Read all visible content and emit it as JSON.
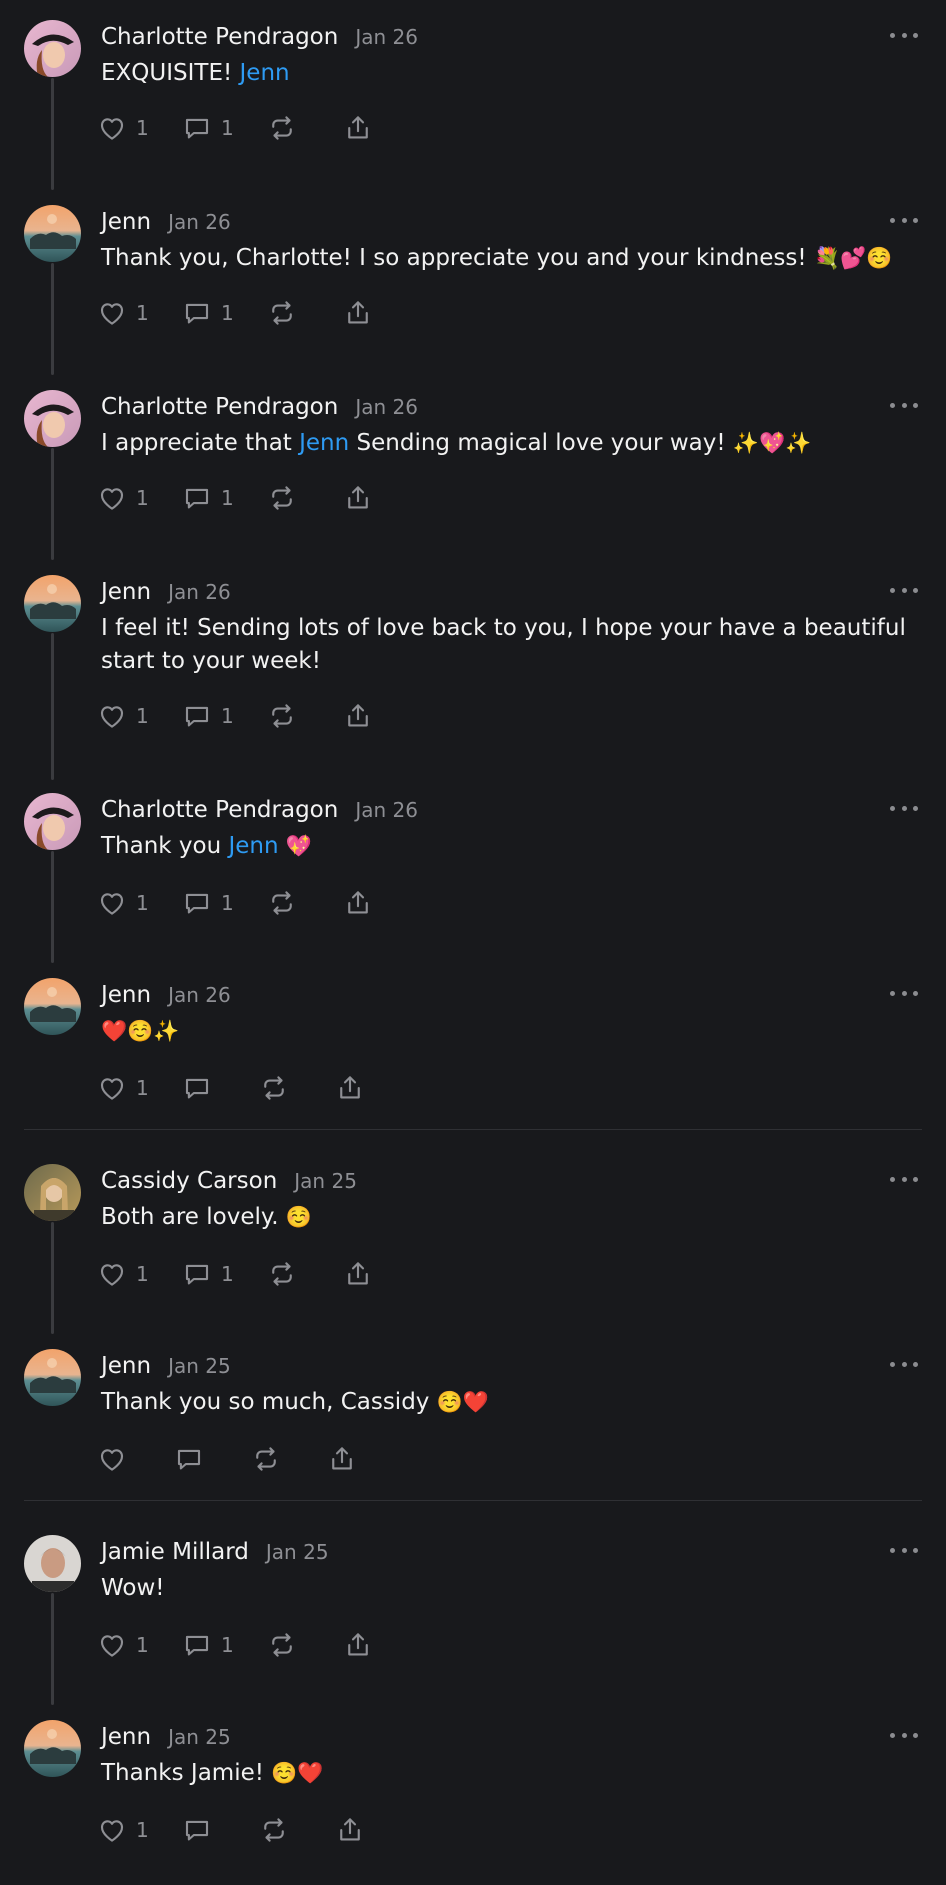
{
  "colors": {
    "background": "#18191c",
    "text": "#f2f2f2",
    "muted": "#8e8f94",
    "mention": "#2e9bf3",
    "thread_line": "#3a3b3f"
  },
  "icons": [
    "heart-icon",
    "comment-icon",
    "repost-icon",
    "share-icon",
    "more-icon"
  ],
  "posts": [
    {
      "author": "Charlotte Pendragon",
      "date": "Jan 26",
      "avatar": "avatar-charlotte",
      "segments": [
        {
          "t": "EXQUISITE! "
        },
        {
          "t": "Jenn",
          "mention": true
        }
      ],
      "likes": "1",
      "comments": "1"
    },
    {
      "author": "Jenn",
      "date": "Jan 26",
      "avatar": "avatar-jenn",
      "segments": [
        {
          "t": "Thank you, Charlotte! I so appreciate you and your kindness! "
        },
        {
          "t": "💐💕☺️",
          "emoji": true
        }
      ],
      "likes": "1",
      "comments": "1"
    },
    {
      "author": "Charlotte Pendragon",
      "date": "Jan 26",
      "avatar": "avatar-charlotte",
      "segments": [
        {
          "t": "I appreciate that "
        },
        {
          "t": "Jenn",
          "mention": true
        },
        {
          "t": " Sending magical love your way! "
        },
        {
          "t": "✨💖✨",
          "emoji": true
        }
      ],
      "likes": "1",
      "comments": "1"
    },
    {
      "author": "Jenn",
      "date": "Jan 26",
      "avatar": "avatar-jenn",
      "segments": [
        {
          "t": "I feel it! Sending lots of love back to you, I hope your have a beautiful start to your week!"
        }
      ],
      "likes": "1",
      "comments": "1"
    },
    {
      "author": "Charlotte Pendragon",
      "date": "Jan 26",
      "avatar": "avatar-charlotte",
      "segments": [
        {
          "t": "Thank you "
        },
        {
          "t": "Jenn",
          "mention": true
        },
        {
          "t": " "
        },
        {
          "t": "💖",
          "emoji": true
        }
      ],
      "likes": "1",
      "comments": "1"
    },
    {
      "author": "Jenn",
      "date": "Jan 26",
      "avatar": "avatar-jenn",
      "segments": [
        {
          "t": "❤️☺️✨",
          "emoji": true
        }
      ],
      "likes": "1",
      "comments": ""
    },
    {
      "author": "Cassidy Carson",
      "date": "Jan 25",
      "avatar": "avatar-cassidy",
      "segments": [
        {
          "t": "Both are lovely. "
        },
        {
          "t": "☺️",
          "emoji": true
        }
      ],
      "likes": "1",
      "comments": "1"
    },
    {
      "author": "Jenn",
      "date": "Jan 25",
      "avatar": "avatar-jenn",
      "segments": [
        {
          "t": "Thank you so much, Cassidy "
        },
        {
          "t": "☺️❤️",
          "emoji": true
        }
      ],
      "likes": "",
      "comments": ""
    },
    {
      "author": "Jamie Millard",
      "date": "Jan 25",
      "avatar": "avatar-jamie",
      "segments": [
        {
          "t": "Wow!"
        }
      ],
      "likes": "1",
      "comments": "1"
    },
    {
      "author": "Jenn",
      "date": "Jan 25",
      "avatar": "avatar-jenn",
      "segments": [
        {
          "t": "Thanks Jamie! "
        },
        {
          "t": "☺️❤️",
          "emoji": true
        }
      ],
      "likes": "1",
      "comments": ""
    }
  ]
}
